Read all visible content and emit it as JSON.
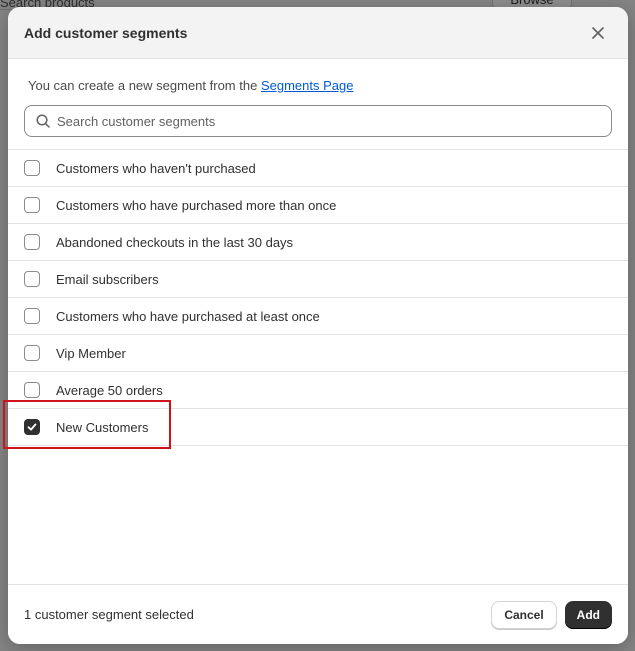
{
  "background": {
    "search_text": "Search products",
    "browse_label": "Browse"
  },
  "modal": {
    "title": "Add customer segments",
    "info_text": "You can create a new segment from the ",
    "info_link": "Segments Page",
    "search_placeholder": "Search customer segments",
    "segments": [
      {
        "label": "Customers who haven't purchased",
        "checked": false
      },
      {
        "label": "Customers who have purchased more than once",
        "checked": false
      },
      {
        "label": "Abandoned checkouts in the last 30 days",
        "checked": false
      },
      {
        "label": "Email subscribers",
        "checked": false
      },
      {
        "label": "Customers who have purchased at least once",
        "checked": false
      },
      {
        "label": "Vip Member",
        "checked": false
      },
      {
        "label": "Average 50 orders",
        "checked": false
      },
      {
        "label": "New Customers",
        "checked": true
      }
    ],
    "footer_status": "1 customer segment selected",
    "cancel_label": "Cancel",
    "add_label": "Add"
  },
  "colors": {
    "link": "#005bd3",
    "primary_button": "#303030",
    "highlight": "#d0121b"
  }
}
